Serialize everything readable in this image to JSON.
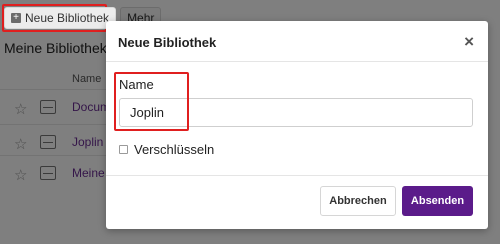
{
  "toolbar": {
    "new_library_label": "Neue Bibliothek",
    "more_label": "Mehr"
  },
  "page": {
    "heading": "Meine Bibliotheken",
    "name_column": "Name ▲",
    "libraries": [
      {
        "name": "Documents"
      },
      {
        "name": "Joplin"
      },
      {
        "name": "Meine Bibliothek"
      }
    ]
  },
  "dialog": {
    "title": "Neue Bibliothek",
    "close_icon": "×",
    "name_label": "Name",
    "name_value": "Joplin",
    "encrypt_label": "Verschlüsseln",
    "encrypt_checked": false,
    "cancel_label": "Abbrechen",
    "submit_label": "Absenden"
  },
  "colors": {
    "primary": "#5b1b8a",
    "highlight": "#e01f1f",
    "link": "#6a2c93"
  }
}
